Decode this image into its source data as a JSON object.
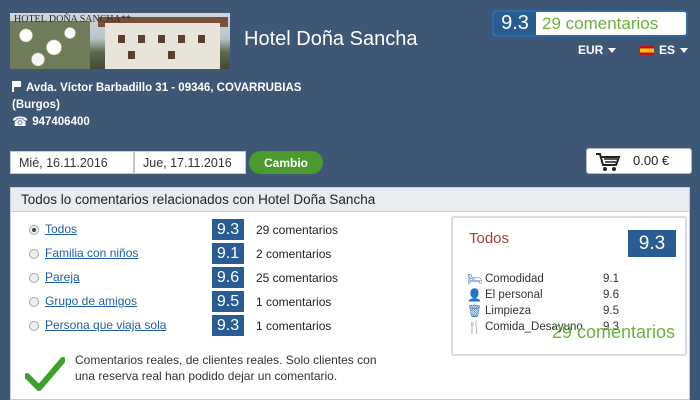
{
  "header": {
    "photo_caption": "HOTEL DOÑA SANCHA**",
    "hotel_name": "Hotel Doña Sancha",
    "rating": {
      "score": "9.3",
      "comments": "29 comentarios"
    },
    "currency": "EUR",
    "language": "ES",
    "address_line1": "Avda. Víctor Barbadillo 31 - 09346, COVARRUBIAS",
    "address_line2": "(Burgos)",
    "phone": "947406400"
  },
  "booking": {
    "checkin": "Mié, 16.11.2016",
    "checkout": "Jue, 17.11.2016",
    "change_label": "Cambio",
    "cart_total": "0.00 €"
  },
  "reviews": {
    "heading": "Todos lo comentarios relacionados con Hotel Doña Sancha",
    "filters": [
      {
        "label": "Todos",
        "score": "9.3",
        "count": "29 comentarios",
        "selected": true
      },
      {
        "label": "Familia con niños",
        "score": "9.1",
        "count": "2 comentarios",
        "selected": false
      },
      {
        "label": "Pareja",
        "score": "9.6",
        "count": "25 comentarios",
        "selected": false
      },
      {
        "label": "Grupo de amigos",
        "score": "9.5",
        "count": "1 comentarios",
        "selected": false
      },
      {
        "label": "Persona que viaja sola",
        "score": "9.3",
        "count": "1 comentarios",
        "selected": false
      }
    ],
    "note": "Comentarios reales, de clientes reales. Solo clientes con una reserva real han podido dejar un comentario.",
    "summary": {
      "title": "Todos",
      "score": "9.3",
      "categories": [
        {
          "icon": "bed-icon",
          "label": "Comodidad",
          "value": "9.1"
        },
        {
          "icon": "person-icon",
          "label": "El personal",
          "value": "9.6"
        },
        {
          "icon": "cleaning-icon",
          "label": "Limpieza",
          "value": "9.5"
        },
        {
          "icon": "cutlery-icon",
          "label": "Comida_Desayuno",
          "value": "9.3"
        }
      ],
      "count": "29 comentarios"
    }
  },
  "colors": {
    "header_bg": "#3d5775",
    "score_badge": "#2a5c94",
    "green": "#6ab23f",
    "link": "#1f5fa8"
  }
}
